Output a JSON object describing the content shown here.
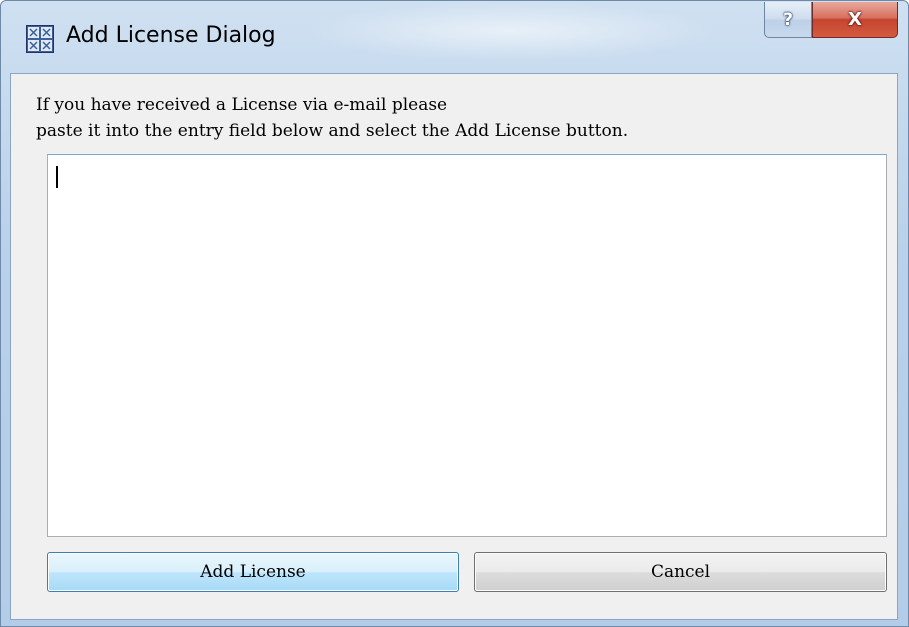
{
  "window": {
    "title": "Add License Dialog",
    "icon": "license-app-icon",
    "help_label": "?",
    "close_label": "X"
  },
  "dialog": {
    "instruction_line1": "If you have received a License via e-mail please",
    "instruction_line2": "paste it into the entry field below and select the Add License button.",
    "license_input": {
      "value": "",
      "placeholder": ""
    },
    "add_button_label": "Add License",
    "cancel_button_label": "Cancel"
  },
  "colors": {
    "accent": "#3c7fb1",
    "close_button": "#c4452f",
    "title_frame": "#b9d1ea",
    "client_background": "#f0f0f0"
  }
}
